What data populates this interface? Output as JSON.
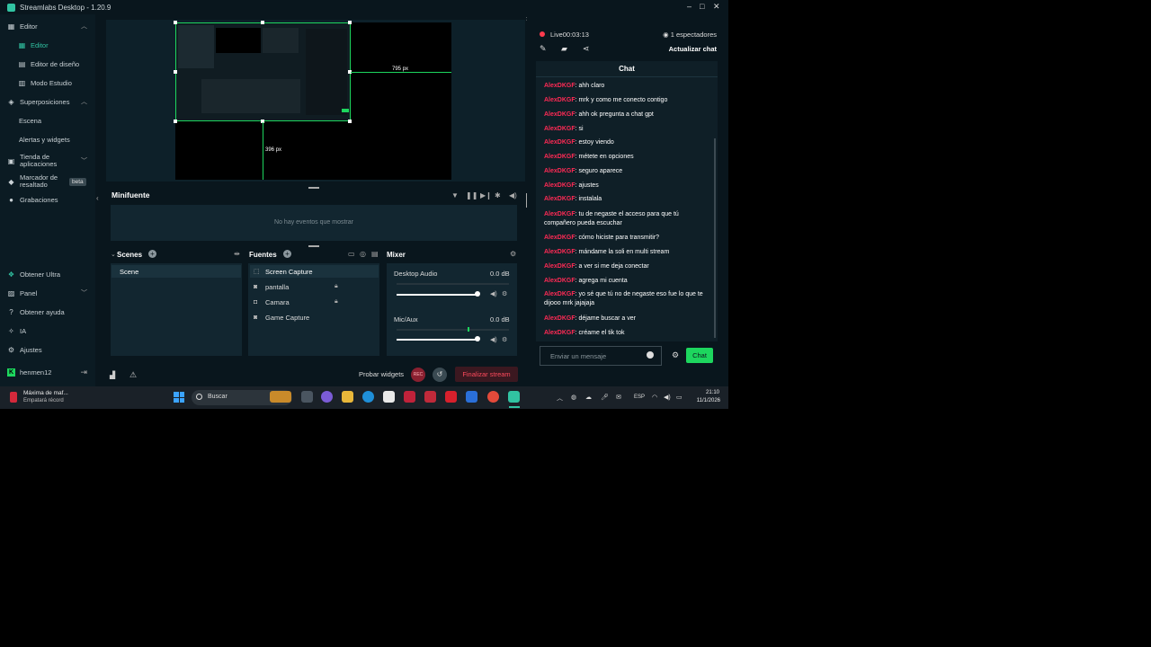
{
  "window": {
    "title": "Streamlabs Desktop - 1.20.9",
    "minimize": "–",
    "maximize": "□",
    "close": "✕"
  },
  "sidebar": {
    "items": [
      {
        "label": "Editor",
        "icon": "editor-icon"
      },
      {
        "label": "Editor",
        "icon": "editor-icon"
      },
      {
        "label": "Editor de diseño",
        "icon": "layout-icon"
      },
      {
        "label": "Modo Estudio",
        "icon": "studio-icon"
      },
      {
        "label": "Superposiciones",
        "icon": "overlays-icon"
      },
      {
        "label": "Escena",
        "icon": ""
      },
      {
        "label": "Alertas y widgets",
        "icon": ""
      },
      {
        "label": "Tienda de aplicaciones",
        "icon": "store-icon"
      },
      {
        "label": "Marcador de resaltado",
        "icon": "highlighter-icon",
        "badge": "beta"
      },
      {
        "label": "Grabaciones",
        "icon": "recordings-icon"
      },
      {
        "label": "Obtener Ultra",
        "icon": "ultra-icon"
      },
      {
        "label": "Panel",
        "icon": "dashboard-icon"
      },
      {
        "label": "Obtener ayuda",
        "icon": "help-icon"
      },
      {
        "label": "IA",
        "icon": "ai-icon"
      },
      {
        "label": "Ajustes",
        "icon": "gear-icon"
      },
      {
        "label": "henmen12",
        "icon": "kick-icon"
      }
    ]
  },
  "preview": {
    "width_label": "795 px",
    "height_label": "396 px"
  },
  "minifuente": {
    "title": "Minifuente",
    "empty": "No hay eventos que mostrar"
  },
  "scenes": {
    "title": "Scenes",
    "items": [
      "Scene"
    ]
  },
  "sources": {
    "title": "Fuentes",
    "items": [
      {
        "label": "Screen Capture",
        "icon": "screen-capture-icon"
      },
      {
        "label": "pantalla",
        "icon": "gamepad-icon"
      },
      {
        "label": "Camara",
        "icon": "camera-icon"
      },
      {
        "label": "Game Capture",
        "icon": "gamepad-icon"
      }
    ]
  },
  "mixer": {
    "title": "Mixer",
    "channels": [
      {
        "name": "Desktop Audio",
        "db": "0.0 dB",
        "volume": 1.0
      },
      {
        "name": "Mic/Aux",
        "db": "0.0 dB",
        "volume": 1.0
      }
    ]
  },
  "footer": {
    "probar": "Probar widgets",
    "rec": "REC",
    "finalizar": "Finalizar stream"
  },
  "chat_panel": {
    "live": "Live00:03:13",
    "viewers": "1 espectadores",
    "refresh": "Actualizar chat",
    "title": "Chat",
    "input_placeholder": "Enviar un mensaje",
    "send": "Chat",
    "messages": [
      {
        "user": "AlexDKGF",
        "text": ": ahh claro"
      },
      {
        "user": "AlexDKGF",
        "text": ": mrk y como me conecto contigo"
      },
      {
        "user": "AlexDKGF",
        "text": ": ahh ok pregunta a chat gpt"
      },
      {
        "user": "AlexDKGF",
        "text": ": si"
      },
      {
        "user": "AlexDKGF",
        "text": ": estoy viendo"
      },
      {
        "user": "AlexDKGF",
        "text": ": métete en opciones"
      },
      {
        "user": "AlexDKGF",
        "text": ": seguro aparece"
      },
      {
        "user": "AlexDKGF",
        "text": ": ajustes"
      },
      {
        "user": "AlexDKGF",
        "text": ": instalala"
      },
      {
        "user": "AlexDKGF",
        "text": ": tu de negaste el acceso para que tú compañero pueda escuchar"
      },
      {
        "user": "AlexDKGF",
        "text": ": cómo hiciste para transmitir?"
      },
      {
        "user": "AlexDKGF",
        "text": ": mándame la soli en multi stream"
      },
      {
        "user": "AlexDKGF",
        "text": ": a ver si me deja conectar"
      },
      {
        "user": "AlexDKGF",
        "text": ": agrega mi cuenta"
      },
      {
        "user": "AlexDKGF",
        "text": ": yo sé que tú no de negaste eso fue lo que te dijooo mrk jajajaja"
      },
      {
        "user": "AlexDKGF",
        "text": ": déjame buscar a ver"
      },
      {
        "user": "AlexDKGF",
        "text": ": créame el tik tok"
      }
    ]
  },
  "taskbar": {
    "weather_line1": "Máxima de maf...",
    "weather_line2": "Empatará récord",
    "search": "Buscar",
    "lang": "ESP",
    "time": "21:10",
    "date": "11/1/2026"
  },
  "colors": {
    "accent": "#31c3a2",
    "live": "#ff3b4e",
    "chat_user": "#ff2a55",
    "send": "#1dd65e"
  }
}
